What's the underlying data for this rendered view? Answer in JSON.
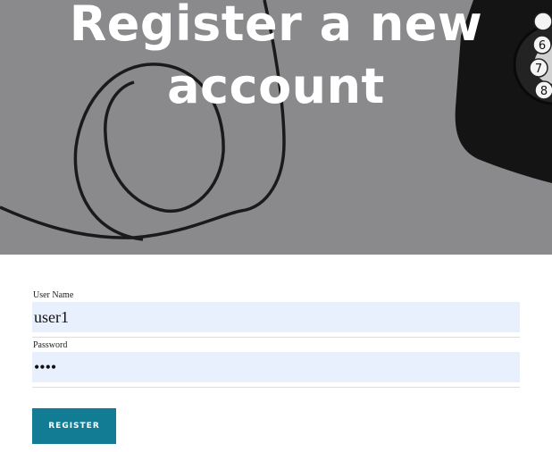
{
  "hero": {
    "title_line1": "Register a new",
    "title_line2": "account"
  },
  "form": {
    "username_label": "User Name",
    "username_value": "user1",
    "password_label": "Password",
    "password_value": "test",
    "register_label": "REGISTER"
  },
  "colors": {
    "hero_bg": "#8a8a8c",
    "input_bg": "#e8effd",
    "button_bg": "#127c94"
  }
}
